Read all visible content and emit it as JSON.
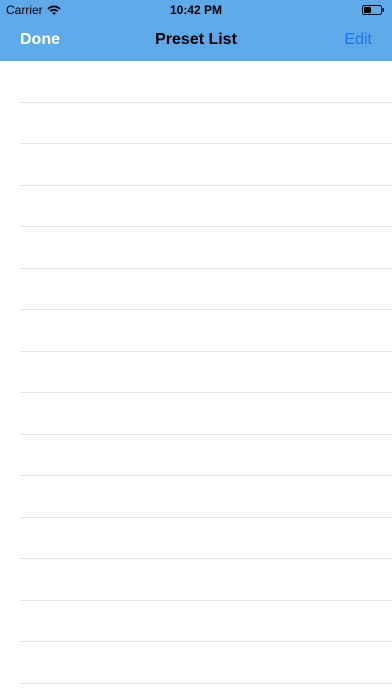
{
  "status_bar": {
    "carrier": "Carrier",
    "time": "10:42 PM",
    "wifi_icon": "wifi-icon",
    "battery_icon": "battery-icon"
  },
  "nav_bar": {
    "left_button": "Done",
    "title": "Preset List",
    "right_button": "Edit"
  },
  "colors": {
    "nav_background": "#5fa9e8",
    "edit_tint": "#1a74ea",
    "separator": "#e3e3e6"
  },
  "list": {
    "row_count": 15
  }
}
